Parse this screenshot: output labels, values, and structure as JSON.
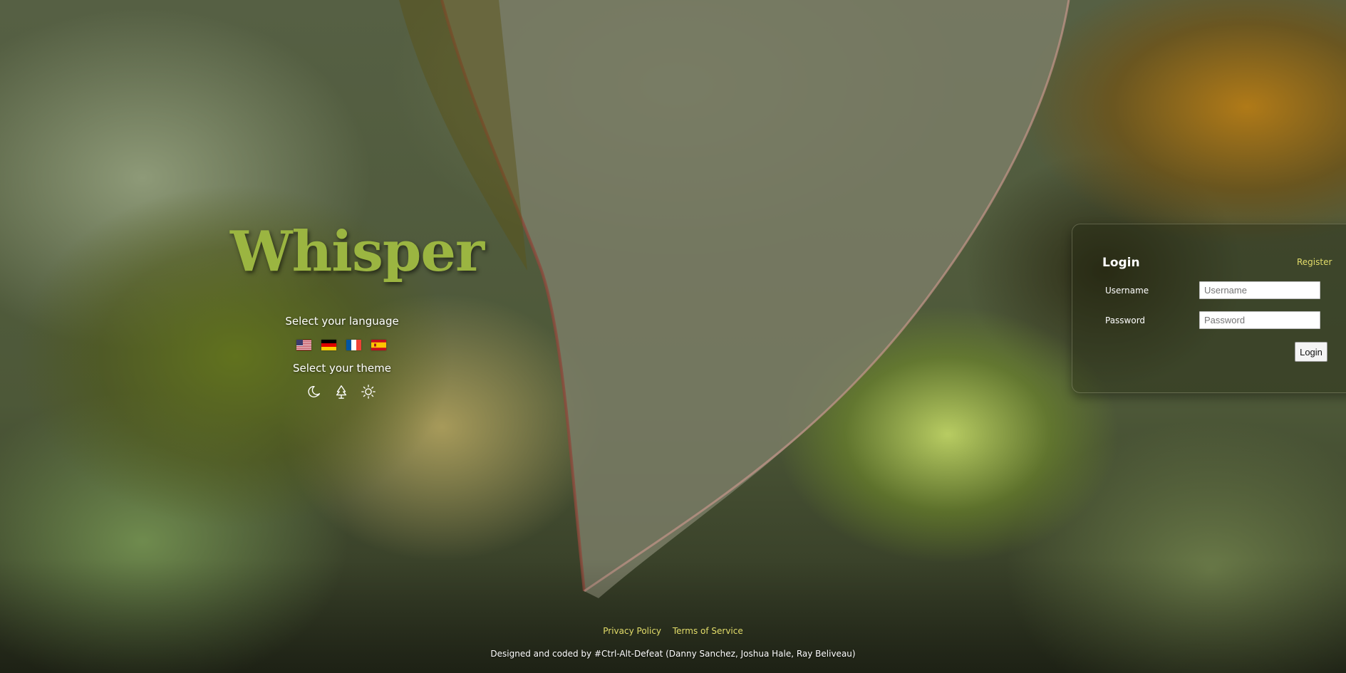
{
  "app": {
    "title": "Whisper"
  },
  "language": {
    "label": "Select your language",
    "flags": [
      {
        "icon": "us-flag-icon"
      },
      {
        "icon": "german-flag-icon"
      },
      {
        "icon": "french-flag-icon"
      },
      {
        "icon": "spanish-flag-icon"
      }
    ]
  },
  "theme": {
    "label": "Select your theme",
    "options": [
      {
        "icon": "moon-icon"
      },
      {
        "icon": "tree-icon"
      },
      {
        "icon": "sun-icon"
      }
    ]
  },
  "login": {
    "title": "Login",
    "register_label": "Register",
    "username_label": "Username",
    "username_placeholder": "Username",
    "username_value": "",
    "password_label": "Password",
    "password_placeholder": "Password",
    "password_value": "",
    "submit_label": "Login"
  },
  "footer": {
    "privacy_label": "Privacy Policy",
    "terms_label": "Terms of Service",
    "credits": "Designed and coded by #Ctrl-Alt-Defeat (Danny Sanchez, Joshua Hale, Ray Beliveau)"
  },
  "colors": {
    "brand": "#9bb541",
    "link": "#e3dd6a"
  }
}
